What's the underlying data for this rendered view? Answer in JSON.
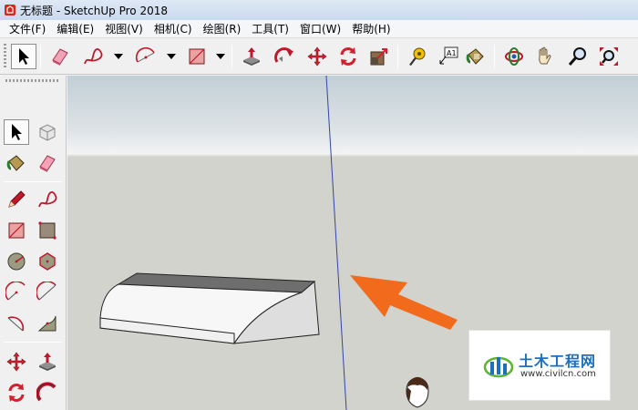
{
  "window": {
    "title": "无标题 - SketchUp Pro 2018",
    "icon": "sketchup-logo-icon"
  },
  "menubar": {
    "items": [
      {
        "label": "文件(F)"
      },
      {
        "label": "编辑(E)"
      },
      {
        "label": "视图(V)"
      },
      {
        "label": "相机(C)"
      },
      {
        "label": "绘图(R)"
      },
      {
        "label": "工具(T)"
      },
      {
        "label": "窗口(W)"
      },
      {
        "label": "帮助(H)"
      }
    ]
  },
  "toolbar": {
    "selected": "select-tool",
    "tools": [
      "select-tool",
      "eraser-tool",
      "freehand-tool",
      "arc-tool",
      "rectangle-tool",
      "push-pull-tool",
      "follow-me-tool",
      "move-tool",
      "rotate-tool",
      "scale-tool",
      "tape-measure-tool",
      "text-tool",
      "paint-bucket-tool",
      "orbit-tool",
      "pan-tool",
      "zoom-tool",
      "zoom-extents-tool"
    ],
    "text_tool_label": "A1"
  },
  "left_toolbar": {
    "selected": "select-tool",
    "tools": [
      "select-tool",
      "component-tool",
      "paint-bucket-tool",
      "eraser-tool",
      "line-tool",
      "freehand-tool",
      "rectangle-tool",
      "rotated-rectangle-tool",
      "circle-tool",
      "polygon-tool",
      "arc-tool",
      "two-point-arc-tool",
      "pie-tool",
      "three-point-arc-tool",
      "move-tool",
      "push-pull-tool",
      "rotate-tool",
      "follow-me-tool"
    ]
  },
  "viewport": {
    "colors": {
      "sky": "#c2cfd6",
      "ground": "#d3d3cd",
      "axis": "#3344aa",
      "arrow": "#f26a1b"
    },
    "objects": [
      "range-hood-model",
      "blue-axis",
      "annotation-arrow",
      "person-figure"
    ]
  },
  "watermark": {
    "title": "土木工程网",
    "url": "www.civilcn.com",
    "colors": {
      "primary": "#1c6fbf",
      "accent": "#5cb531"
    }
  }
}
